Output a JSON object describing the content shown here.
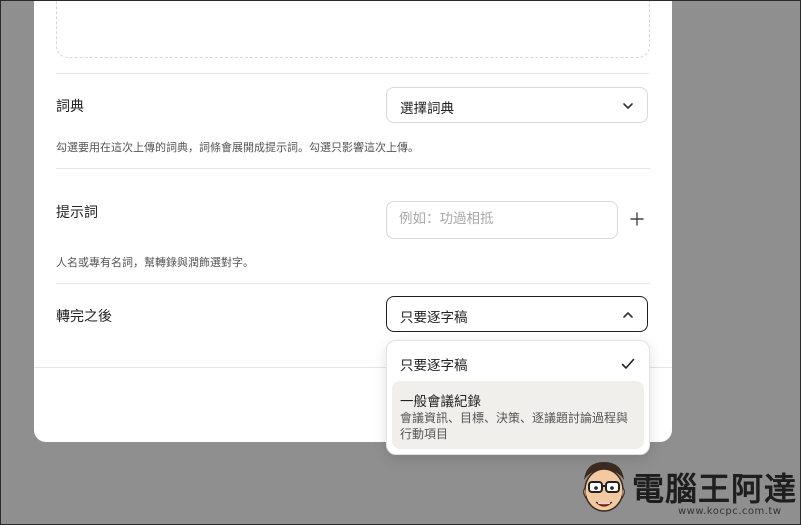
{
  "dictionary": {
    "label": "詞典",
    "select_value": "選擇詞典",
    "hint": "勾選要用在這次上傳的詞典，詞條會展開成提示詞。勾選只影響這次上傳。"
  },
  "prompt_words": {
    "label": "提示詞",
    "placeholder": "例如：功過相抵",
    "hint": "人名或專有名詞，幫轉錄與潤飾選對字。"
  },
  "after_transcription": {
    "label": "轉完之後",
    "select_value": "只要逐字稿",
    "options": [
      {
        "title": "只要逐字稿",
        "selected": true
      },
      {
        "title": "一般會議紀錄",
        "description": "會議資訊、目標、決策、逐議題討論過程與行動項目",
        "highlighted": true
      }
    ]
  },
  "watermark": {
    "brand": "電腦王阿達",
    "site": "www.kocpc.com.tw"
  },
  "icons": {
    "dictionary_chevron": "chevron-down-icon",
    "after_chevron": "chevron-up-icon",
    "add": "plus-icon",
    "selected": "check-icon"
  }
}
